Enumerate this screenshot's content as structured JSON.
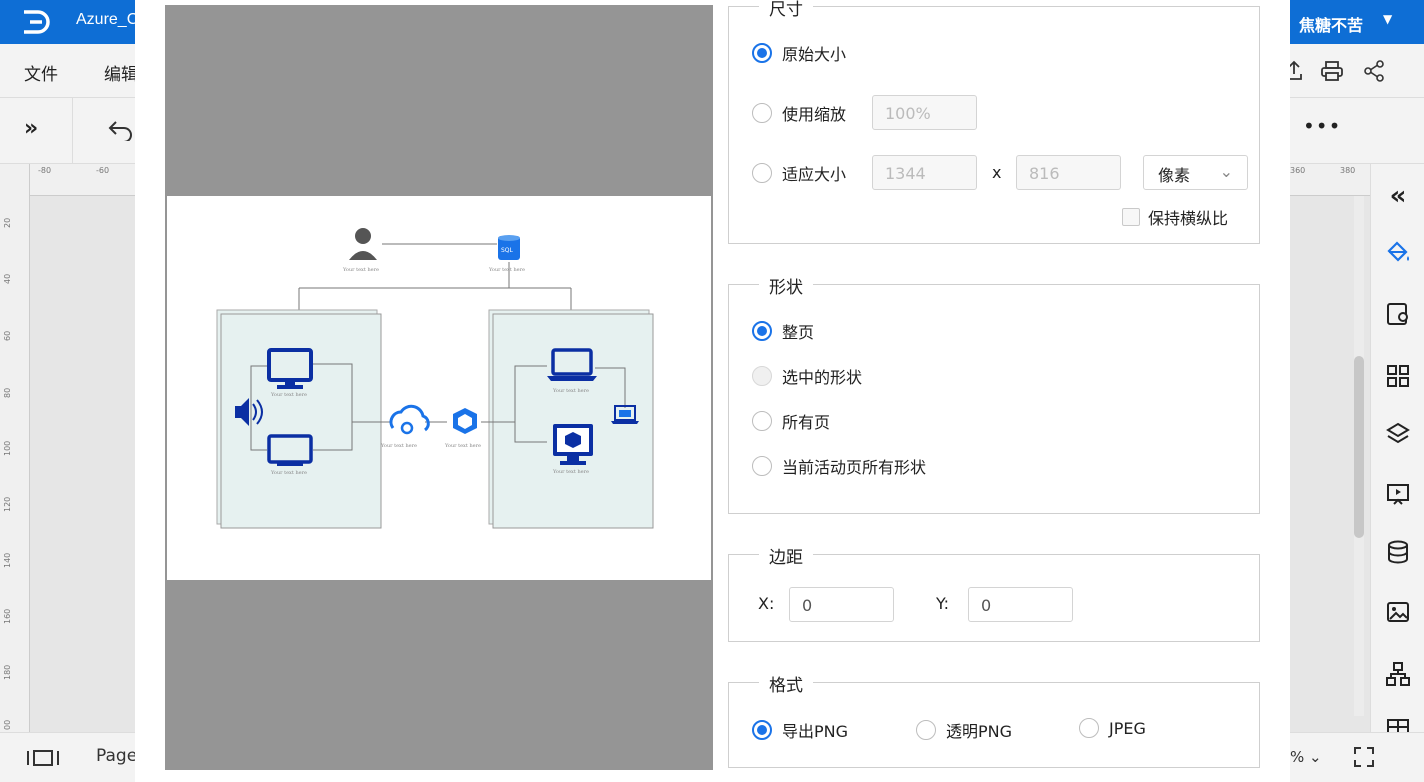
{
  "app": {
    "title": "Azure_C",
    "user": "焦糖不苦"
  },
  "menu": {
    "file": "文件",
    "edit": "编辑"
  },
  "ruler": {
    "top": [
      "-80",
      "-60",
      "360",
      "380"
    ],
    "left": [
      "20",
      "40",
      "60",
      "80",
      "100",
      "120",
      "140",
      "160",
      "180",
      "00"
    ]
  },
  "status": {
    "page_label": "Page",
    "zoom": "%"
  },
  "diagram": {
    "node_label": "Your text here",
    "db_label": "SQL"
  },
  "dialog": {
    "size": {
      "legend": "尺寸",
      "original": "原始大小",
      "scale": "使用缩放",
      "scale_value": "100%",
      "fit": "适应大小",
      "width": "1344",
      "x_sep": "x",
      "height": "816",
      "unit": "像素",
      "keep_ratio": "保持横纵比"
    },
    "shape": {
      "legend": "形状",
      "whole_page": "整页",
      "selected": "选中的形状",
      "all_pages": "所有页",
      "current_page": "当前活动页所有形状"
    },
    "margin": {
      "legend": "边距",
      "x_label": "X:",
      "x_value": "0",
      "y_label": "Y:",
      "y_value": "0"
    },
    "format": {
      "legend": "格式",
      "png": "导出PNG",
      "transparent_png": "透明PNG",
      "jpeg": "JPEG"
    }
  },
  "colors": {
    "accent": "#1a73e8",
    "topbar": "#0e6ed5",
    "diagram_blue": "#0b2fa3",
    "group_fill": "#e6f1f0"
  }
}
